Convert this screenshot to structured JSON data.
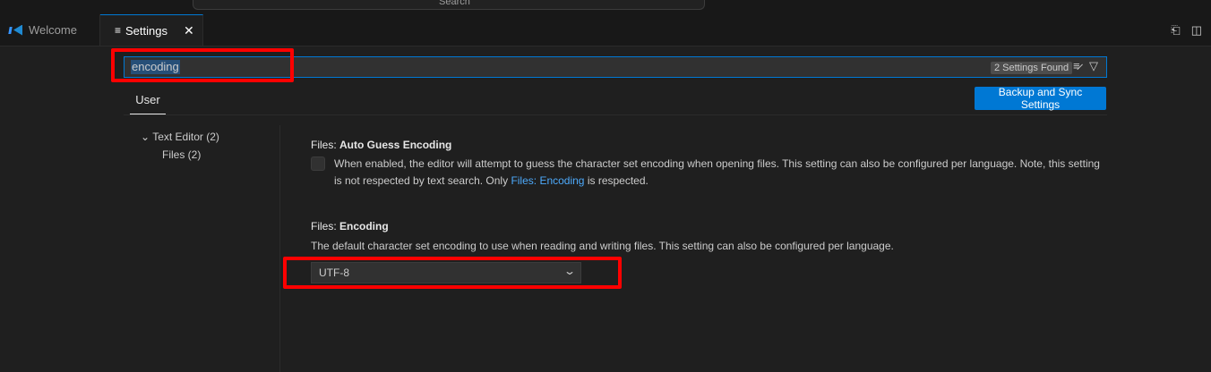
{
  "titlebar": {
    "command_center_text": "Search"
  },
  "tabs": [
    {
      "label": "Welcome",
      "icon": "vscode-logo-icon",
      "active": false
    },
    {
      "label": "Settings",
      "icon": "settings-list-icon",
      "active": true,
      "close_glyph": "✕"
    }
  ],
  "editor_actions": {
    "open_json_glyph": "⎗",
    "split_glyph": "◫"
  },
  "search": {
    "value": "encoding",
    "results_badge": "2 Settings Found"
  },
  "scope_tab": "User",
  "sync_button": "Backup and Sync Settings",
  "toc": [
    {
      "label": "Text Editor (2)",
      "expanded": true
    },
    {
      "label": "Files (2)"
    }
  ],
  "settings": [
    {
      "category": "Files: ",
      "name": "Auto Guess Encoding",
      "description_1": "When enabled, the editor will attempt to guess the character set encoding when opening files. This setting can also be configured per language. Note, this setting is not respected by text search. Only ",
      "link": "Files: Encoding",
      "description_2": " is respected.",
      "checked": false
    },
    {
      "category": "Files: ",
      "name": "Encoding",
      "description": "The default character set encoding to use when reading and writing files. This setting can also be configured per language.",
      "value": "UTF-8"
    }
  ],
  "colors": {
    "accent": "#0078d4",
    "highlight": "#ff0000",
    "link": "#4daafc"
  }
}
